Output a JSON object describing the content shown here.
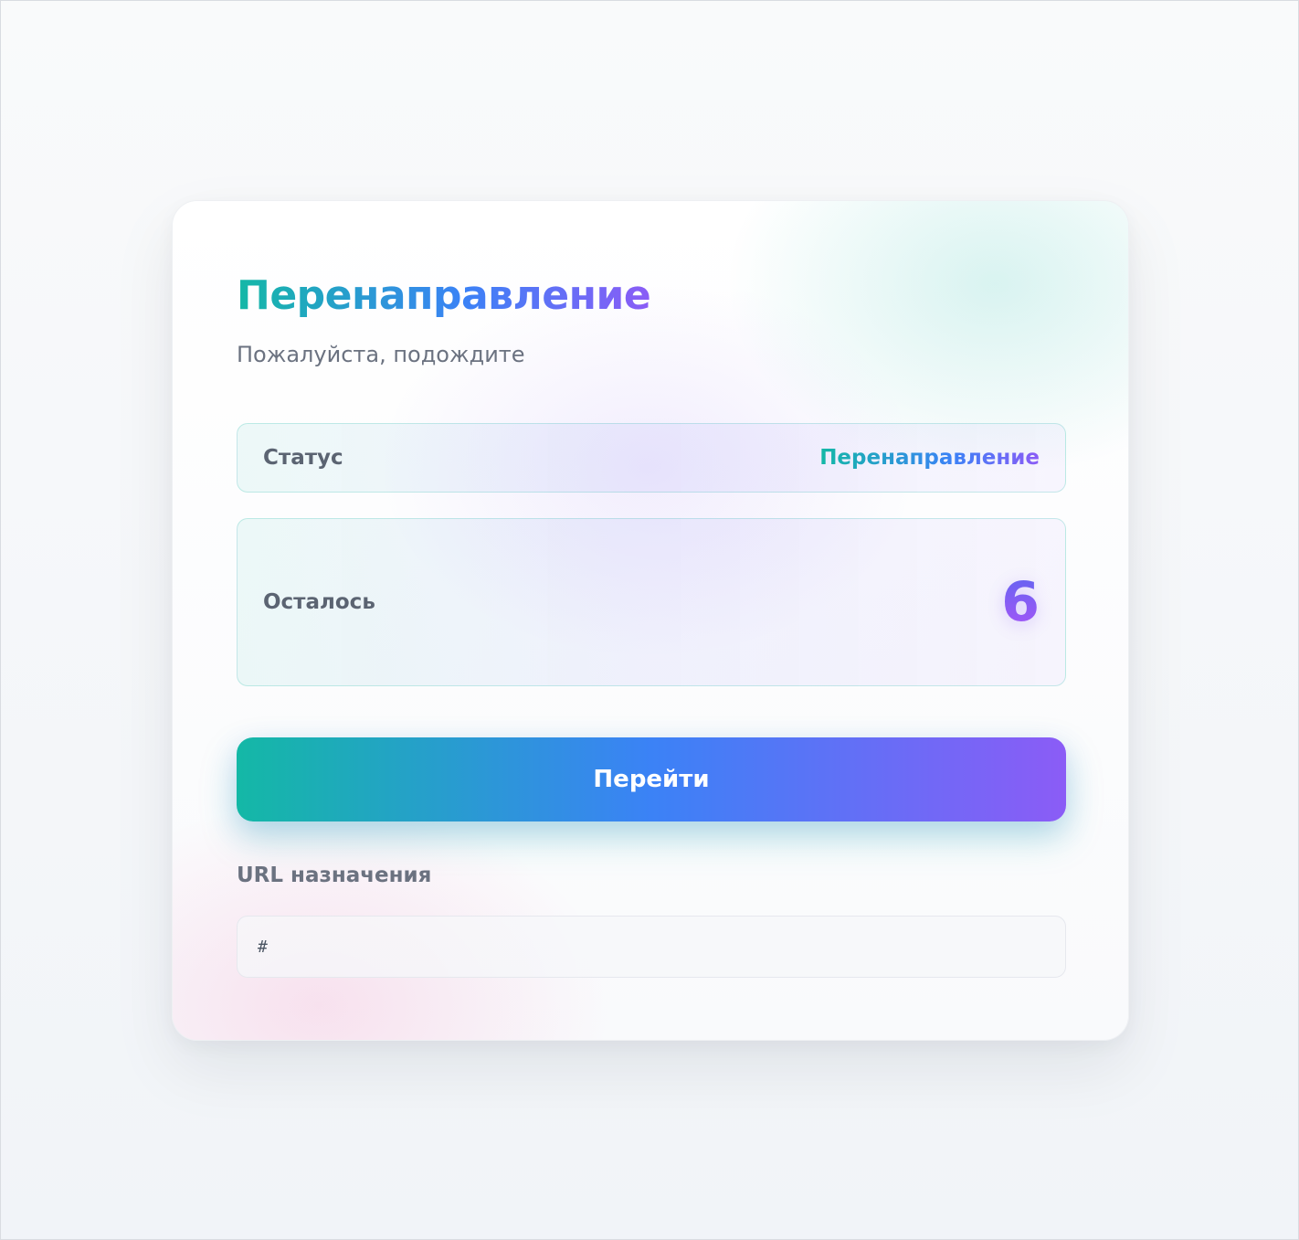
{
  "page": {
    "title": "Перенаправление",
    "subtitle": "Пожалуйста, подождите"
  },
  "status": {
    "label": "Статус",
    "value": "Перенаправление"
  },
  "countdown": {
    "label": "Осталось",
    "value": "6"
  },
  "actions": {
    "go_label": "Перейти"
  },
  "destination": {
    "label": "URL назначения",
    "value": "#"
  },
  "colors": {
    "accent_start": "#14b8a6",
    "accent_mid": "#3b82f6",
    "accent_end": "#8b5cf6"
  }
}
